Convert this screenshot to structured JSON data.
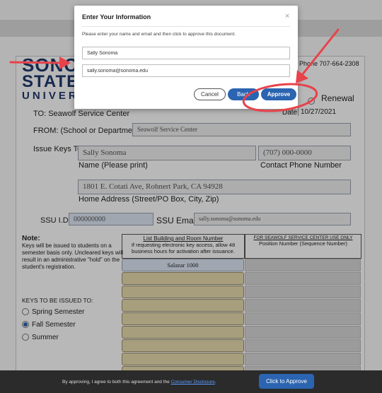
{
  "modal": {
    "title": "Enter Your Information",
    "close": "×",
    "instructions": "Please enter your name and email and then click to approve this document.",
    "name_value": "Sally Sonoma",
    "email_value": "sally.sonoma@sonoma.edu",
    "cancel_label": "Cancel",
    "back_label": "Back",
    "approve_label": "Approve"
  },
  "document": {
    "logo": {
      "line1": "SONO",
      "line2": "STATE",
      "line3": "UNIVERS"
    },
    "phone": "Phone 707-664-2308",
    "renewal_label": "Renewal",
    "date_label": "Date:",
    "date_value": "10/27/2021",
    "to_label": "TO:  Seawolf Service Center",
    "from_label": "FROM: (School or Department)",
    "from_value": "Seawolf Service Center",
    "issue_keys_label": "Issue Keys To:",
    "name_field": "Sally Sonoma",
    "name_caption": "Name (Please print)",
    "phone_field": "(707) 000-0000",
    "phone_caption": "Contact Phone Number",
    "address_field": "1801 E. Cotati Ave, Rohnert Park, CA 94928",
    "address_caption": "Home Address (Street/PO Box, City, Zip)",
    "ssu_id_label": "SSU I.D.",
    "ssu_id_value": "000000000",
    "ssu_email_label": "SSU Email",
    "ssu_email_value": "sally.sonoma@sonoma.edu",
    "note_title": "Note:",
    "note_text": "Keys will be issued to students on a semester basis only. Uncleared keys will result in an administrative \"hold\" on the student's registration.",
    "col1_header": "List Building and Room Number",
    "col1_sub": "If requesting electronic key access, allow 48 business hours for activation after issuance.",
    "col2_header": "FOR SEAWOLF SERVICE CENTER USE ONLY",
    "col2_sub": "Position Number (Sequence Number)",
    "first_room": "Salazar 1000",
    "keys_heading": "KEYS TO BE ISSUED TO:",
    "semesters": [
      {
        "label": "Spring Semester",
        "checked": false
      },
      {
        "label": "Fall Semester",
        "checked": true
      },
      {
        "label": "Summer",
        "checked": false
      }
    ]
  },
  "footer": {
    "agree_prefix": "By approving, I agree to both this agreement and the ",
    "agree_link": "Consumer Disclosure",
    "agree_suffix": ".",
    "cta_label": "Click to Approve"
  },
  "colors": {
    "accent": "#2b64b0",
    "arrow": "#e8424a",
    "highlight_circle": "#e8424a"
  }
}
